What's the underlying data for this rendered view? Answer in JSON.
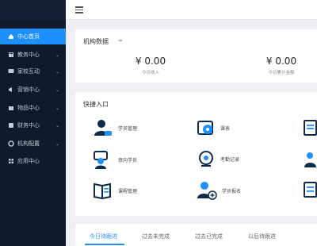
{
  "sidebar": {
    "items": [
      {
        "label": "中心首页",
        "icon": "home-icon",
        "active": true,
        "has_arrow": false
      },
      {
        "label": "教务中心",
        "icon": "book-icon",
        "active": false,
        "has_arrow": true
      },
      {
        "label": "家校互动",
        "icon": "chat-icon",
        "active": false,
        "has_arrow": true
      },
      {
        "label": "营销中心",
        "icon": "megaphone-icon",
        "active": false,
        "has_arrow": true
      },
      {
        "label": "物品中心",
        "icon": "box-icon",
        "active": false,
        "has_arrow": true
      },
      {
        "label": "财务中心",
        "icon": "finance-icon",
        "active": false,
        "has_arrow": true
      },
      {
        "label": "机构配置",
        "icon": "settings-icon",
        "active": false,
        "has_arrow": true
      },
      {
        "label": "应用中心",
        "icon": "apps-icon",
        "active": false,
        "has_arrow": false
      }
    ]
  },
  "overview": {
    "title": "机构数据",
    "toggle_symbol": "∞",
    "stats": [
      {
        "value": "¥ 0.00",
        "label": "今日收入"
      },
      {
        "value": "¥ 0.00",
        "label": "今日累计金额"
      }
    ]
  },
  "quick_entry": {
    "title": "快捷入口",
    "items": [
      {
        "label": "学员管理",
        "icon": "student-icon"
      },
      {
        "label": "课表",
        "icon": "schedule-icon"
      },
      {
        "label": "",
        "icon": "document-icon"
      },
      {
        "label": "意向学员",
        "icon": "prospect-icon"
      },
      {
        "label": "考勤记录",
        "icon": "attendance-icon"
      },
      {
        "label": "",
        "icon": "teacher-icon"
      },
      {
        "label": "课程管理",
        "icon": "course-icon"
      },
      {
        "label": "学员报名",
        "icon": "enroll-icon"
      },
      {
        "label": "",
        "icon": "report-icon"
      }
    ]
  },
  "tabs": [
    {
      "label": "今日待跟进",
      "active": true
    },
    {
      "label": "过去未完成",
      "active": false
    },
    {
      "label": "过去已完成",
      "active": false
    },
    {
      "label": "以后待跟进",
      "active": false
    }
  ],
  "colors": {
    "accent": "#1e8fff",
    "sidebar_bg": "#0f1a2e",
    "icon_dark": "#0e2a4f",
    "icon_blue": "#1e8fff"
  }
}
